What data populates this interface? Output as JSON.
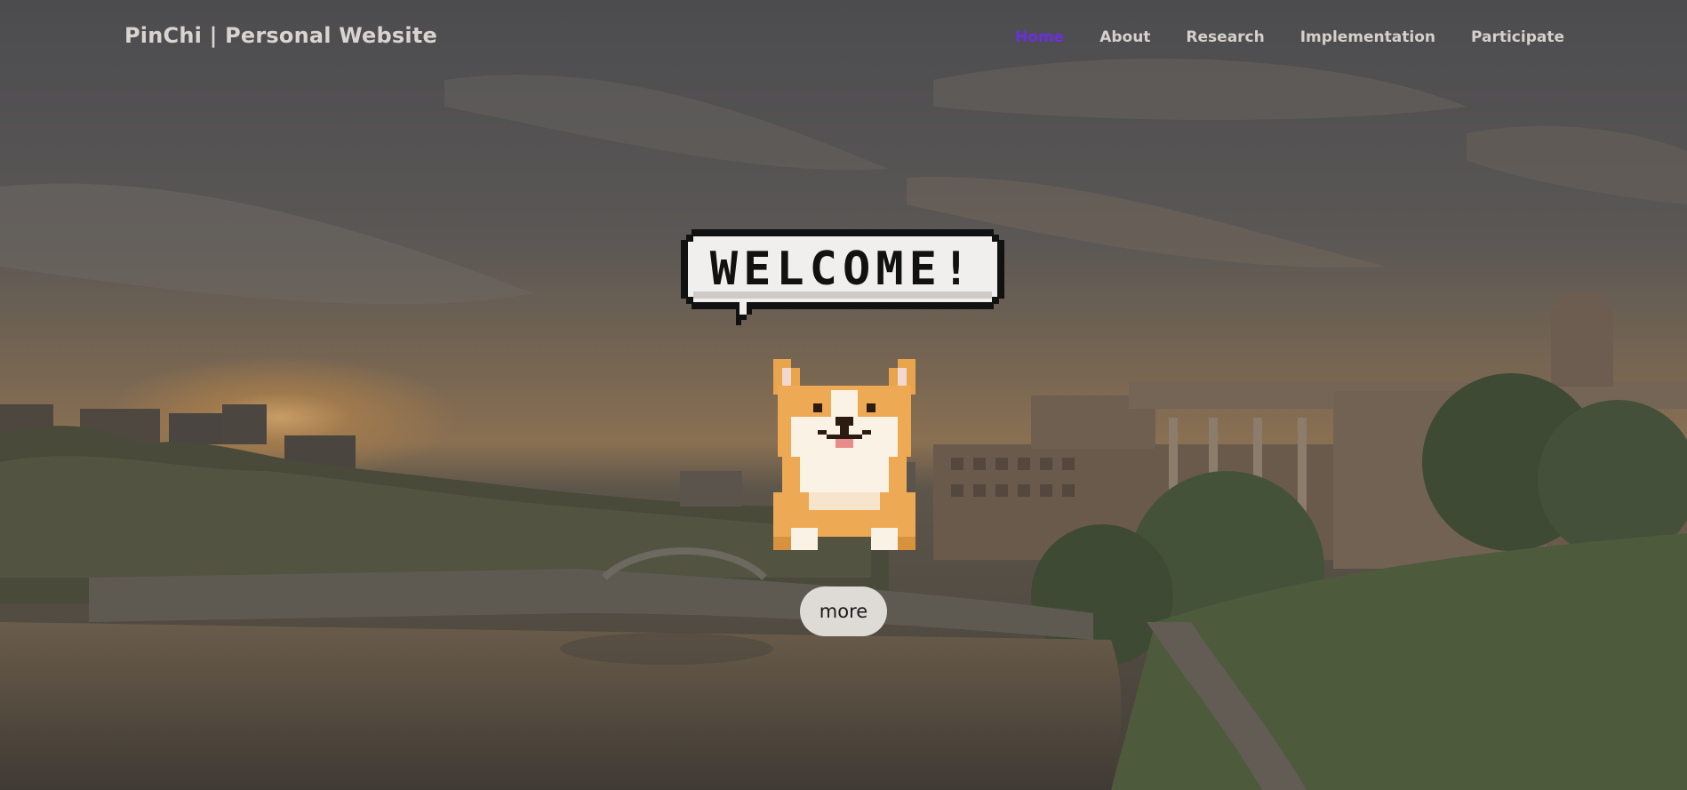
{
  "header": {
    "brand": "PinChi | Personal Website",
    "nav": [
      {
        "label": "Home",
        "active": true
      },
      {
        "label": "About",
        "active": false
      },
      {
        "label": "Research",
        "active": false
      },
      {
        "label": "Implementation",
        "active": false
      },
      {
        "label": "Participate",
        "active": false
      }
    ],
    "active_color": "#6b2fe0",
    "nav_color": "#d5d0ca"
  },
  "hero": {
    "welcome_text": "WELCOME!",
    "mascot": "pixel-corgi-icon",
    "more_label": "more"
  },
  "colors": {
    "overlay": "#3e3e40",
    "sky": "#5b5b5c",
    "sunset": "#b5864a",
    "water": "#4a433b",
    "button_bg": "#dedad6"
  }
}
